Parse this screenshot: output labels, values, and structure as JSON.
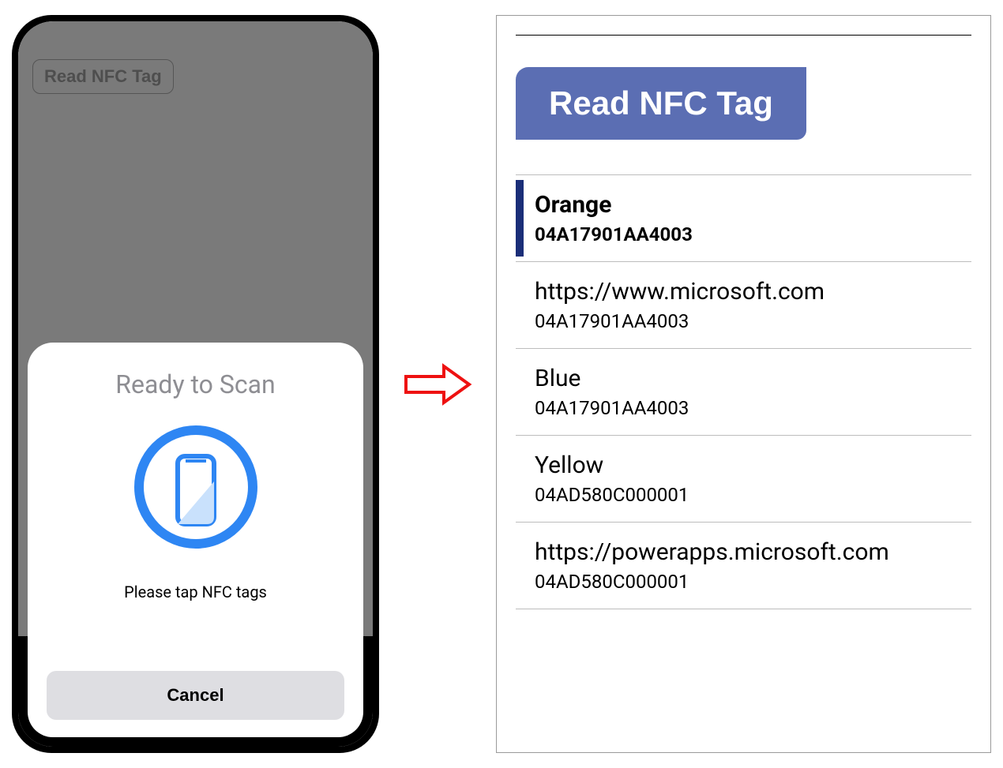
{
  "left": {
    "read_button": "Read NFC Tag",
    "sheet": {
      "title": "Ready to Scan",
      "message": "Please tap NFC tags",
      "cancel": "Cancel"
    }
  },
  "right": {
    "read_button": "Read NFC Tag",
    "items": [
      {
        "title": "Orange",
        "sub": "04A17901AA4003",
        "selected": true
      },
      {
        "title": "https://www.microsoft.com",
        "sub": "04A17901AA4003",
        "selected": false
      },
      {
        "title": "Blue",
        "sub": "04A17901AA4003",
        "selected": false
      },
      {
        "title": "Yellow",
        "sub": "04AD580C000001",
        "selected": false
      },
      {
        "title": "https://powerapps.microsoft.com",
        "sub": "04AD580C000001",
        "selected": false
      }
    ]
  }
}
